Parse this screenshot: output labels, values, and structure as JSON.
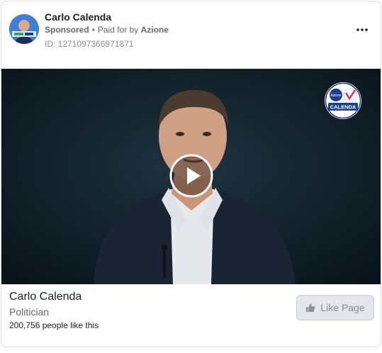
{
  "header": {
    "page_name": "Carlo Calenda",
    "sponsored_label": "Sponsored",
    "separator": "•",
    "paid_for_prefix": "Paid for by",
    "paid_for_by": "Azione",
    "ad_id": "ID: 1271097366971871"
  },
  "media": {
    "type": "video",
    "logo_text": {
      "party": "Azione",
      "name": "CALENDA"
    }
  },
  "footer": {
    "page_name": "Carlo Calenda",
    "category": "Politician",
    "likes": "200,756 people like this",
    "like_button_label": "Like Page"
  },
  "colors": {
    "primary_text": "#1c1e21",
    "secondary_text": "#65676b",
    "video_background": "#0f1b22",
    "button_background": "#e4e6eb",
    "brand_blue": "#1d3f8f"
  },
  "icons": [
    "more-options-icon",
    "play-icon",
    "thumbs-up-icon"
  ]
}
